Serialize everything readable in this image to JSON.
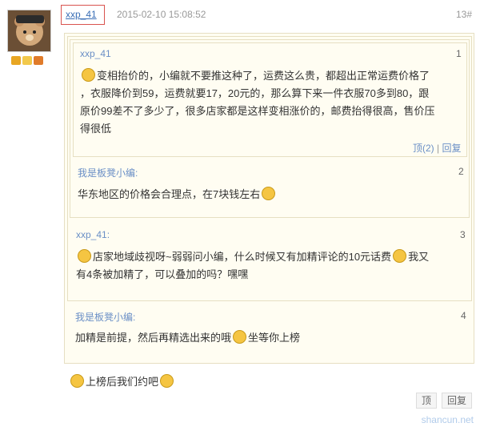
{
  "post": {
    "username": "xxp_41",
    "timestamp": "2015-02-10 15:08:52",
    "floor": "13#",
    "reply_text": "上榜后我们约吧"
  },
  "quotes": [
    {
      "username": "xxp_41",
      "number": "1",
      "text_lines": [
        "变相抬价的，小编就不要推这种了，运费这么贵，都超出正常运费价格了",
        "，衣服降价到59，运费就要17，20元的，那么算下来一件衣服70多到80，跟",
        "原价99差不了多少了，很多店家都是这样变相涨价的，邮费抬得很高，售价压",
        "得很低"
      ],
      "links": {
        "top": "顶(2)",
        "reply": "回复"
      }
    },
    {
      "username": "我是板凳小编:",
      "number": "2",
      "text": "华东地区的价格会合理点，在7块钱左右"
    },
    {
      "username": "xxp_41:",
      "number": "3",
      "text_line1": "店家地域歧视呀~弱弱问小编，什么时候又有加精评论的10元话费",
      "text_line1b": "我又",
      "text_line2": "有4条被加精了，可以叠加的吗？嘿嘿"
    },
    {
      "username": "我是板凳小编:",
      "number": "4",
      "text_part1": "加精是前提，然后再精选出来的哦",
      "text_part2": "坐等你上榜"
    }
  ],
  "bottom": {
    "top_button": "顶",
    "reply_button": "回复",
    "watermark": "shancun.net"
  },
  "colors": {
    "quote_bg": "#fffdf2",
    "quote_border": "#e6dfc2",
    "link": "#6a8fc6",
    "username_box": "#d9534f"
  },
  "icons": [
    "avatar-teddy-bear",
    "crown-badge",
    "medal-badge",
    "emoji-face"
  ]
}
